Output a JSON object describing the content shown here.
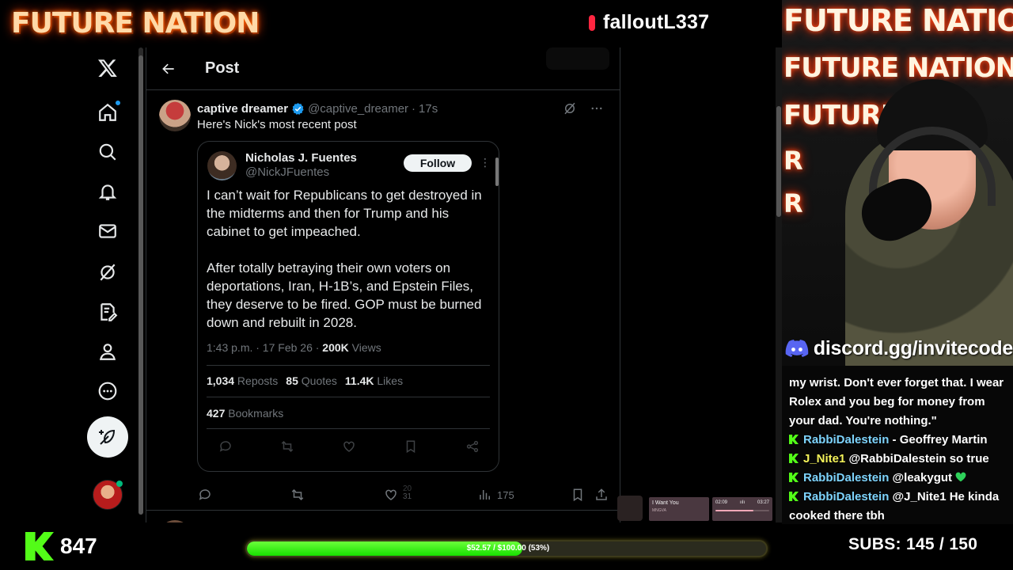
{
  "overlay": {
    "brand": "FUTURE NATION",
    "channel": "falloutL337",
    "discord": "discord.gg/invitecode",
    "webcam_neon": [
      "FUTURE NATION",
      "FUTURE NATION",
      "FUTURE",
      "R",
      "R"
    ],
    "viewers": "847",
    "goal": {
      "text": "$52.57 / $100.00 (53%)",
      "fraction": 0.53
    },
    "subs": "SUBS:  145 / 150",
    "accent_green": "#53fc18"
  },
  "music": {
    "title": "I Want You",
    "artist": "MNGVA",
    "elapsed": "02:09",
    "total": "03:27",
    "progress": 0.7
  },
  "x": {
    "nav": [
      "x-logo",
      "home-icon",
      "search-icon",
      "bell-icon",
      "mail-icon",
      "grok-icon",
      "compose-note-icon",
      "profile-icon",
      "more-icon"
    ],
    "header_title": "Post",
    "tweet": {
      "display_name": "captive dreamer",
      "handle": "@captive_dreamer",
      "sep": "·",
      "time": "17s",
      "text": "Here's Nick's most recent post",
      "actions": {
        "views": "175",
        "likes_partial_top": "20",
        "likes_partial_bottom": "31"
      }
    },
    "embed": {
      "display_name": "Nicholas J. Fuentes",
      "handle": "@NickJFuentes",
      "follow_label": "Follow",
      "paragraphs": [
        "I can’t wait for Republicans to get destroyed in the midterms and then for Trump and his cabinet to get impeached.",
        "After totally betraying their own voters on deportations, Iran, H-1B’s, and Epstein Files, they deserve to be fired. GOP must be burned down and rebuilt in 2028."
      ],
      "timestamp": "1:43 p.m. · 17 Feb 26 · ",
      "views_count": "200K",
      "views_label": " Views",
      "reposts_count": "1,034",
      "reposts_label": " Reposts",
      "quotes_count": "85",
      "quotes_label": " Quotes",
      "likes_count": "11.4K",
      "likes_label": " Likes",
      "bookmarks_count": "427",
      "bookmarks_label": " Bookmarks"
    }
  },
  "chat": {
    "messages": [
      {
        "user": "",
        "text": "my wrist. Don't ever forget that. I wear Rolex and you beg for money from your dad. You're nothing.\""
      },
      {
        "user": "RabbiDalestein",
        "text": " - Geoffrey Martin"
      },
      {
        "user": "J_Nite1",
        "text": " @RabbiDalestein so true"
      },
      {
        "user": "RabbiDalestein",
        "text": " @leakygut "
      },
      {
        "user": "RabbiDalestein",
        "text": " @J_Nite1 He kinda cooked there tbh"
      }
    ]
  }
}
